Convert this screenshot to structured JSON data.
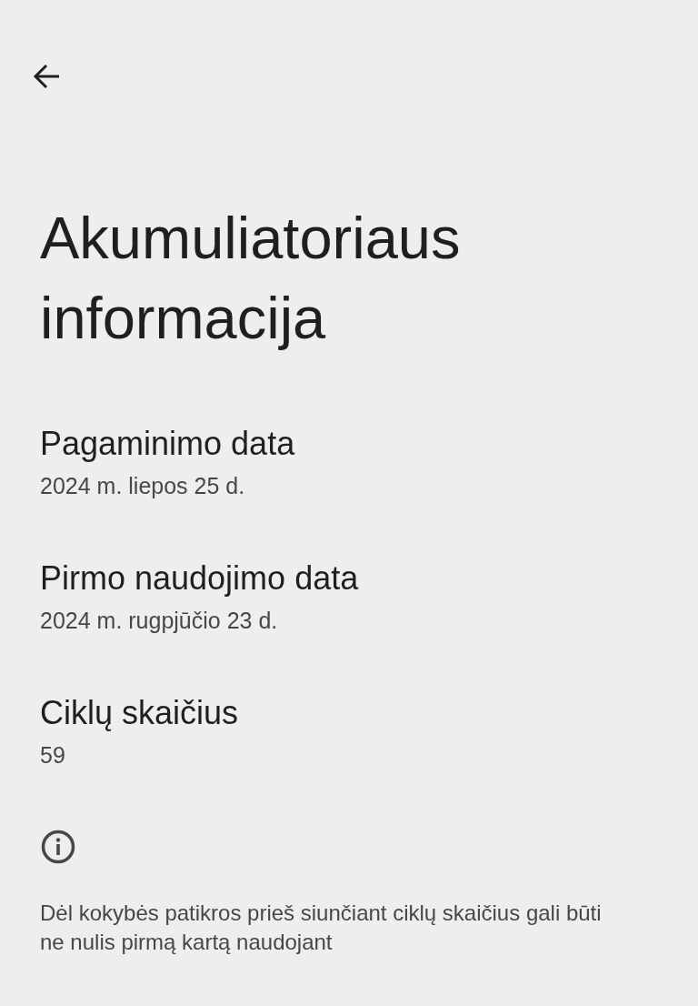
{
  "title": "Akumuliatoriaus informacija",
  "items": [
    {
      "label": "Pagaminimo data",
      "value": "2024 m. liepos 25 d."
    },
    {
      "label": "Pirmo naudojimo data",
      "value": "2024 m. rugpjūčio 23 d."
    },
    {
      "label": "Ciklų skaičius",
      "value": "59"
    }
  ],
  "footer": {
    "note": "Dėl kokybės patikros prieš siunčiant ciklų skaičius gali būti ne nulis pirmą kartą naudojant"
  }
}
